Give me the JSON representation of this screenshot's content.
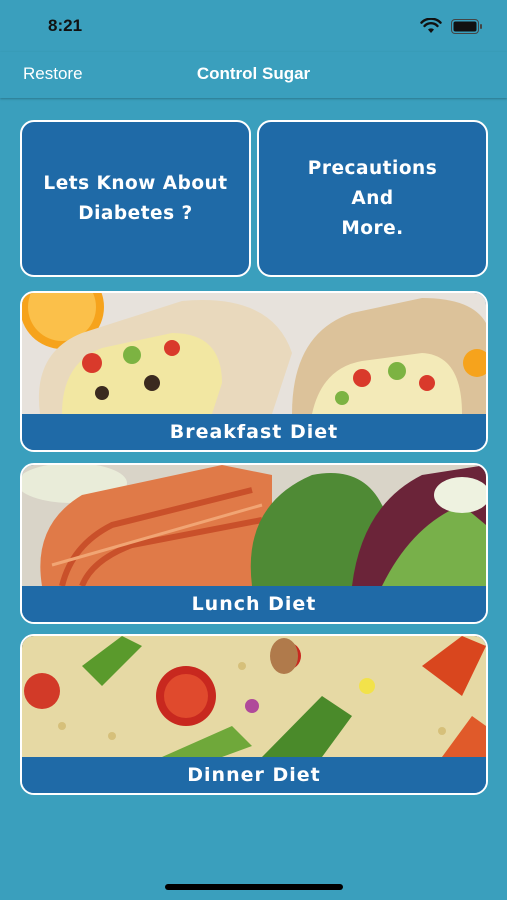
{
  "status_bar": {
    "time": "8:21"
  },
  "nav": {
    "restore_label": "Restore",
    "title": "Control Sugar"
  },
  "cards": {
    "diabetes_label": "Lets Know About\nDiabetes ?",
    "precautions_label": "Precautions\nAnd\nMore."
  },
  "meals": {
    "breakfast_label": "Breakfast Diet",
    "lunch_label": "Lunch Diet",
    "dinner_label": "Dinner Diet"
  },
  "colors": {
    "background": "#3a9fbd",
    "card": "#1f6aa7",
    "border": "#ffffff"
  },
  "icons": [
    "wifi-icon",
    "battery-icon"
  ]
}
